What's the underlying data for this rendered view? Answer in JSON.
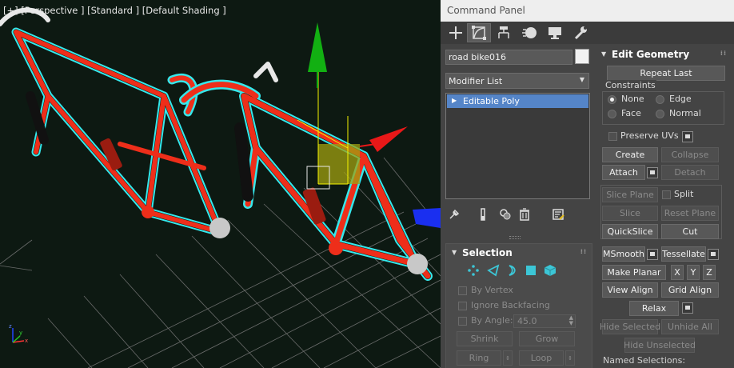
{
  "viewport": {
    "label": "[+] [Perspective ] [Standard ] [Default Shading ]"
  },
  "panel": {
    "title": "Command Panel",
    "tabs": [
      {
        "name": "create",
        "icon": "plus-icon"
      },
      {
        "name": "modify",
        "icon": "modify-icon"
      },
      {
        "name": "hierarchy",
        "icon": "hierarchy-icon"
      },
      {
        "name": "motion",
        "icon": "motion-icon"
      },
      {
        "name": "display",
        "icon": "display-icon"
      },
      {
        "name": "utilities",
        "icon": "wrench-icon"
      }
    ],
    "object_name": "road bike016",
    "object_color": "#f2f2f2",
    "modifier_list": "Modifier List",
    "stack_items": [
      "Editable Poly"
    ]
  },
  "selection": {
    "title": "Selection",
    "subobject_icons": [
      "vertex-icon",
      "edge-icon",
      "border-icon",
      "polygon-icon",
      "element-icon"
    ],
    "by_vertex": "By Vertex",
    "ignore_backfacing": "Ignore Backfacing",
    "by_angle": "By Angle:",
    "angle_value": "45.0",
    "shrink": "Shrink",
    "grow": "Grow",
    "ring": "Ring",
    "loop": "Loop"
  },
  "edit_geometry": {
    "title": "Edit Geometry",
    "repeat_last": "Repeat Last",
    "constraints_label": "Constraints",
    "constraints": {
      "none": "None",
      "edge": "Edge",
      "face": "Face",
      "normal": "Normal"
    },
    "preserve_uvs": "Preserve UVs",
    "create": "Create",
    "collapse": "Collapse",
    "attach": "Attach",
    "detach": "Detach",
    "slice_plane": "Slice Plane",
    "split": "Split",
    "slice": "Slice",
    "reset_plane": "Reset Plane",
    "quickslice": "QuickSlice",
    "cut": "Cut",
    "msmooth": "MSmooth",
    "tessellate": "Tessellate",
    "make_planar": "Make Planar",
    "x": "X",
    "y": "Y",
    "z": "Z",
    "view_align": "View Align",
    "grid_align": "Grid Align",
    "relax": "Relax",
    "hide_selected": "Hide Selected",
    "unhide_all": "Unhide All",
    "hide_unselected": "Hide Unselected",
    "named_selections": "Named Selections:"
  },
  "colors": {
    "accent_blue": "#5585c8",
    "panel_bg": "#444444",
    "viewport_bg": "#0d1912",
    "frame_red": "#ee2e1a",
    "selection_cyan": "#35e8ec"
  }
}
